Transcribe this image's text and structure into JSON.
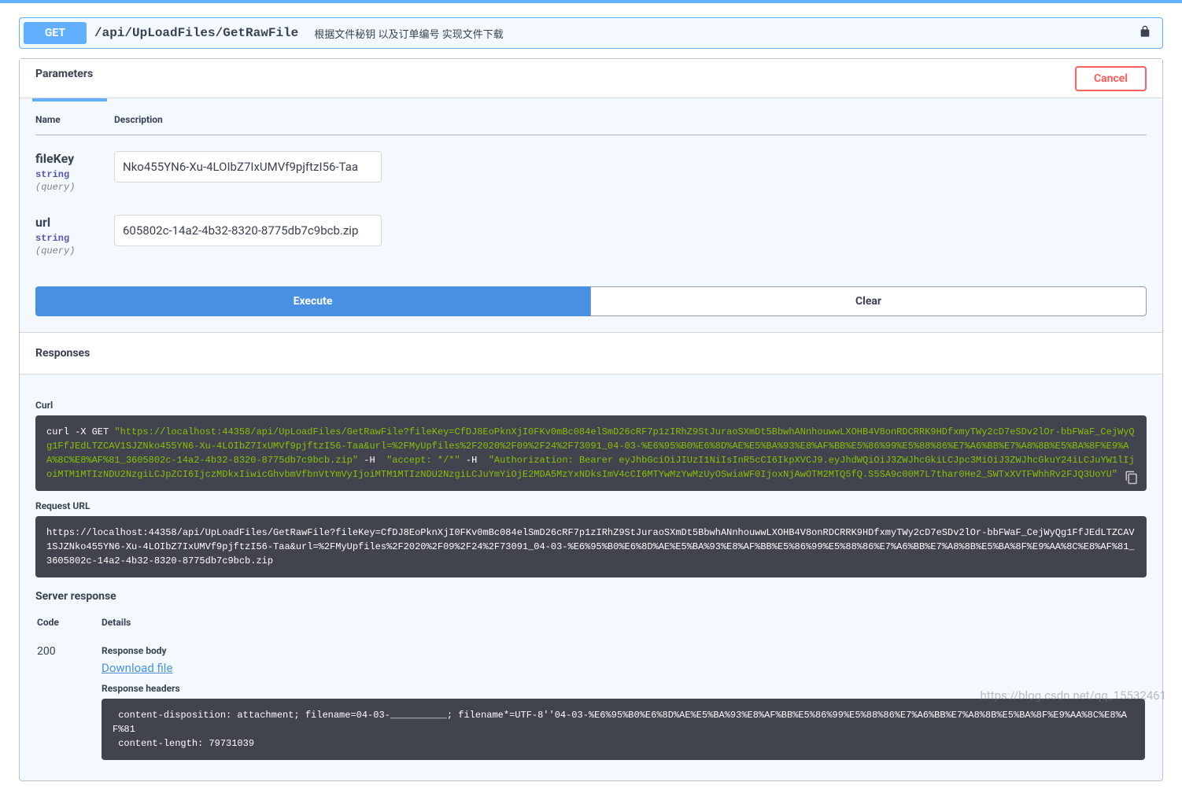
{
  "operation": {
    "method": "GET",
    "path": "/api/UpLoadFiles/GetRawFile",
    "summary": "根据文件秘钥 以及订单编号 实现文件下载"
  },
  "sections": {
    "parameters_title": "Parameters",
    "cancel_label": "Cancel",
    "responses_title": "Responses"
  },
  "param_headers": {
    "name": "Name",
    "description": "Description"
  },
  "params": [
    {
      "name": "fileKey",
      "type": "string",
      "in": "(query)",
      "value": "Nko455YN6-Xu-4LOIbZ7IxUMVf9pjftzI56-Taa"
    },
    {
      "name": "url",
      "type": "string",
      "in": "(query)",
      "value": "605802c-14a2-4b32-8320-8775db7c9bcb.zip"
    }
  ],
  "buttons": {
    "execute": "Execute",
    "clear": "Clear"
  },
  "labels": {
    "curl": "Curl",
    "request_url": "Request URL",
    "server_response": "Server response",
    "code": "Code",
    "details": "Details",
    "response_body": "Response body",
    "download_file": "Download file",
    "response_headers": "Response headers"
  },
  "curl": {
    "cmd_prefix": "curl -X GET ",
    "url": "\"https://localhost:44358/api/UpLoadFiles/GetRawFile?fileKey=CfDJ8EoPknXjI0FKv0mBc084elSmD26cRF7p1zIRhZ9StJuraoSXmDt5BbwhANnhouwwLXOHB4V8onRDCRRK9HDfxmyTWy2cD7eSDv2lOr-bbFWaF_CejWyQg1FfJEdLTZCAV1SJZNko455YN6-Xu-4LOIbZ7IxUMVf9pjftzI56-Taa&url=%2FMyUpfiles%2F2020%2F09%2F24%2F73091_04-03-%E6%95%B0%E6%8D%AE%E5%BA%93%E8%AF%BB%E5%86%99%E5%88%86%E7%A6%BB%E7%A8%8B%E5%BA%8F%E9%AA%8C%E8%AF%81_3605802c-14a2-4b32-8320-8775db7c9bcb.zip\"",
    "flag_h1": " -H  ",
    "hdr_accept": "\"accept: */*\"",
    "flag_h2": " -H  ",
    "hdr_auth": "\"Authorization: Bearer eyJhbGciOiJIUzI1NiIsInR5cCI6IkpXVCJ9.eyJhdWQiOiJ3ZWJhcGkiLCJpc3MiOiJ3ZWJhcGkuY24iLCJuYW1lIjoiMTM1MTIzNDU2NzgiLCJpZCI6IjczMDkxIiwicGhvbmVfbnVtYmVyIjoiMTM1MTIzNDU2NzgiLCJuYmYiOjE2MDA5MzYxNDksImV4cCI6MTYwMzYwMzUyOSwiaWF0IjoxNjAwOTM2MTQ5fQ.S5SA9c00M7L7thar0He2_SWTxXVTFWhhRv2FJQ3UoYU\""
  },
  "request_url": "https://localhost:44358/api/UpLoadFiles/GetRawFile?fileKey=CfDJ8EoPknXjI0FKv0mBc084elSmD26cRF7p1zIRhZ9StJuraoSXmDt5BbwhANnhouwwLXOHB4V8onRDCRRK9HDfxmyTWy2cD7eSDv2lOr-bbFWaF_CejWyQg1FfJEdLTZCAV1SJZNko455YN6-Xu-4LOIbZ7IxUMVf9pjftzI56-Taa&url=%2FMyUpfiles%2F2020%2F09%2F24%2F73091_04-03-%E6%95%B0%E6%8D%AE%E5%BA%93%E8%AF%BB%E5%86%99%E5%88%86%E7%A6%BB%E7%A8%8B%E5%BA%8F%E9%AA%8C%E8%AF%81_3605802c-14a2-4b32-8320-8775db7c9bcb.zip",
  "response": {
    "code": "200",
    "headers": " content-disposition: attachment; filename=04-03-__________; filename*=UTF-8''04-03-%E6%95%B0%E6%8D%AE%E5%BA%93%E8%AF%BB%E5%86%99%E5%88%86%E7%A6%BB%E7%A8%8B%E5%BA%8F%E9%AA%8C%E8%AF%81\n content-length: 79731039"
  },
  "watermark": "https://blog.csdn.net/qq_15532461"
}
